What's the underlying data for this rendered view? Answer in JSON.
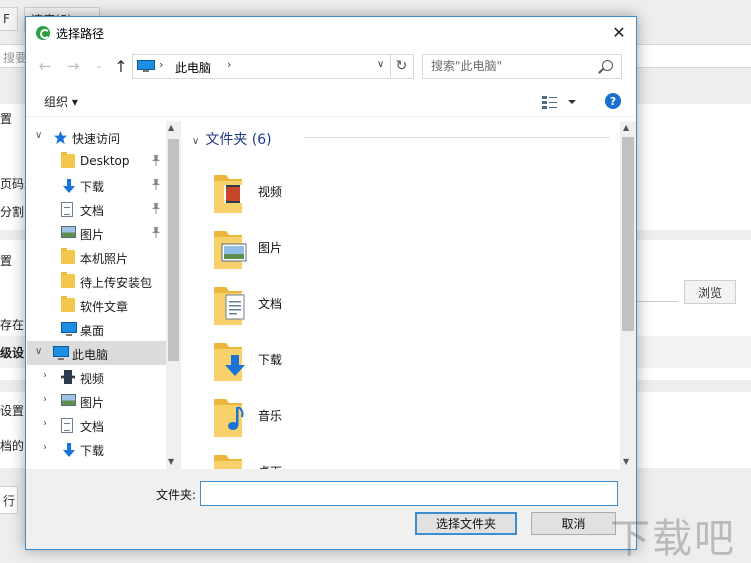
{
  "background": {
    "top_btn_1": "F",
    "top_btn_2": "速度(S)",
    "search_hint": "搜要分",
    "card1_lines": [
      "置",
      "页码处",
      "分割"
    ],
    "card2_lines": [
      "置",
      "存在的",
      "级设"
    ],
    "card3_lines": [
      "设置",
      "档的"
    ],
    "browse_label": "浏览",
    "run_label": "行"
  },
  "dialog": {
    "title": "选择路径",
    "close": "✕",
    "address": {
      "crumb": "此电脑",
      "sep": "›"
    },
    "search_placeholder": "搜索\"此电脑\"",
    "organize": "组织 ▾",
    "help": "?",
    "tree": [
      {
        "label": "快速访问",
        "icon": "star-icon",
        "level": 0,
        "arrow": "∨",
        "pin": false,
        "selected": false
      },
      {
        "label": "Desktop",
        "icon": "folder-icon",
        "level": 1,
        "arrow": "",
        "pin": true,
        "selected": false
      },
      {
        "label": "下载",
        "icon": "download-icon",
        "level": 1,
        "arrow": "",
        "pin": true,
        "selected": false
      },
      {
        "label": "文档",
        "icon": "document-icon",
        "level": 1,
        "arrow": "",
        "pin": true,
        "selected": false
      },
      {
        "label": "图片",
        "icon": "picture-icon",
        "level": 1,
        "arrow": "",
        "pin": true,
        "selected": false
      },
      {
        "label": "本机照片",
        "icon": "folder-icon",
        "level": 1,
        "arrow": "",
        "pin": false,
        "selected": false
      },
      {
        "label": "待上传安装包",
        "icon": "folder-icon",
        "level": 1,
        "arrow": "",
        "pin": false,
        "selected": false
      },
      {
        "label": "软件文章",
        "icon": "folder-icon",
        "level": 1,
        "arrow": "",
        "pin": false,
        "selected": false
      },
      {
        "label": "桌面",
        "icon": "desktop-icon",
        "level": 1,
        "arrow": "",
        "pin": false,
        "selected": false
      },
      {
        "label": "此电脑",
        "icon": "computer-icon",
        "level": 0,
        "arrow": "∨",
        "pin": false,
        "selected": true
      },
      {
        "label": "视频",
        "icon": "video-icon",
        "level": 1,
        "arrow": "›",
        "pin": false,
        "selected": false
      },
      {
        "label": "图片",
        "icon": "picture-icon",
        "level": 1,
        "arrow": "›",
        "pin": false,
        "selected": false
      },
      {
        "label": "文档",
        "icon": "document-icon",
        "level": 1,
        "arrow": "›",
        "pin": false,
        "selected": false
      },
      {
        "label": "下载",
        "icon": "download-icon",
        "level": 1,
        "arrow": "›",
        "pin": false,
        "selected": false
      }
    ],
    "group_header": "文件夹 (6)",
    "items": [
      {
        "label": "视频",
        "overlay": "video-icon"
      },
      {
        "label": "图片",
        "overlay": "picture-icon"
      },
      {
        "label": "文档",
        "overlay": "document-icon"
      },
      {
        "label": "下载",
        "overlay": "download-icon"
      },
      {
        "label": "音乐",
        "overlay": "music-icon"
      },
      {
        "label": "桌面",
        "overlay": "desktop-icon"
      }
    ],
    "footer": {
      "folder_label": "文件夹:",
      "folder_value": "",
      "select_button": "选择文件夹",
      "cancel_button": "取消"
    },
    "colors": {
      "accent": "#3c8ed1",
      "folder": "#f5c84c",
      "header_text": "#1e3a8a"
    }
  },
  "watermark": "下载吧"
}
